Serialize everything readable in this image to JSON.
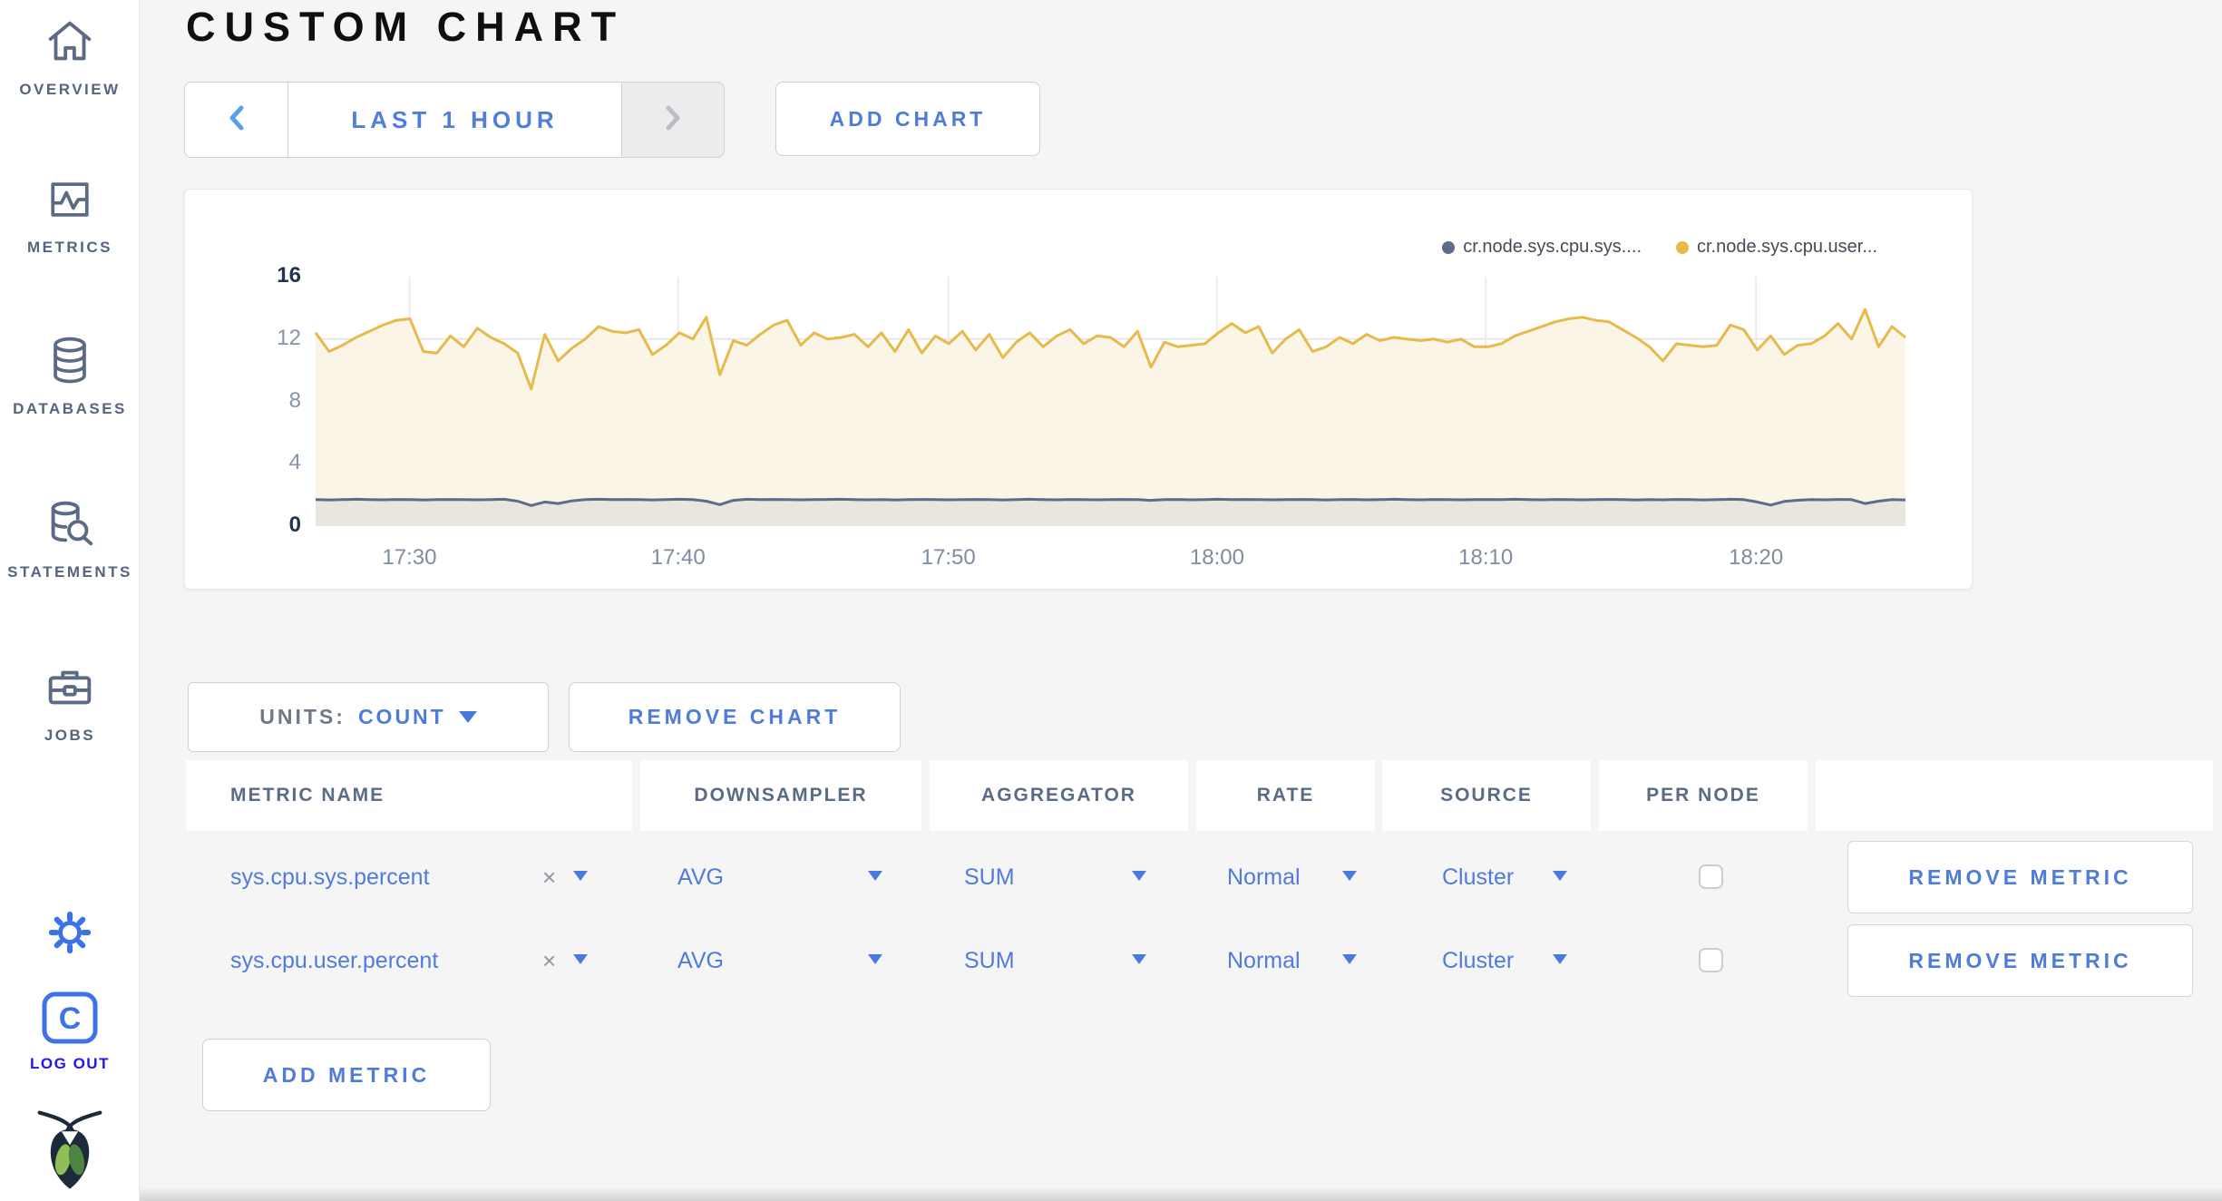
{
  "sidebar": {
    "items": [
      {
        "id": "overview",
        "label": "OVERVIEW"
      },
      {
        "id": "metrics",
        "label": "METRICS"
      },
      {
        "id": "databases",
        "label": "DATABASES"
      },
      {
        "id": "statements",
        "label": "STATEMENTS"
      },
      {
        "id": "jobs",
        "label": "JOBS"
      }
    ],
    "logout_label": "LOG OUT"
  },
  "header": {
    "title": "CUSTOM CHART",
    "time_window": "LAST 1 HOUR",
    "add_chart_label": "ADD CHART"
  },
  "chart_controls": {
    "units_label": "UNITS:",
    "units_value": "COUNT",
    "remove_chart_label": "REMOVE CHART",
    "add_metric_label": "ADD METRIC"
  },
  "table": {
    "columns": [
      "METRIC NAME",
      "DOWNSAMPLER",
      "AGGREGATOR",
      "RATE",
      "SOURCE",
      "PER NODE"
    ],
    "rows": [
      {
        "metric": "sys.cpu.sys.percent",
        "downsampler": "AVG",
        "aggregator": "SUM",
        "rate": "Normal",
        "source": "Cluster",
        "per_node_checked": false,
        "remove_label": "REMOVE METRIC"
      },
      {
        "metric": "sys.cpu.user.percent",
        "downsampler": "AVG",
        "aggregator": "SUM",
        "rate": "Normal",
        "source": "Cluster",
        "per_node_checked": false,
        "remove_label": "REMOVE METRIC"
      }
    ]
  },
  "chart_data": {
    "type": "line",
    "title": "",
    "xlabel": "",
    "ylabel": "",
    "ylim": [
      0,
      16
    ],
    "y_ticks": [
      0,
      4,
      8,
      12,
      16
    ],
    "x_ticks": [
      "17:30",
      "17:40",
      "17:50",
      "18:00",
      "18:10",
      "18:20"
    ],
    "x_tick_fractions": [
      0.059,
      0.228,
      0.398,
      0.567,
      0.736,
      0.906
    ],
    "grid": true,
    "legend_position": "top-right",
    "series": [
      {
        "name": "cr.node.sys.cpu.sys....",
        "color": "#5f6c87",
        "fill": "#e9e6e0",
        "values": [
          1.7,
          1.68,
          1.7,
          1.72,
          1.7,
          1.69,
          1.71,
          1.7,
          1.68,
          1.7,
          1.71,
          1.7,
          1.69,
          1.7,
          1.72,
          1.6,
          1.32,
          1.55,
          1.45,
          1.62,
          1.7,
          1.72,
          1.7,
          1.71,
          1.7,
          1.68,
          1.7,
          1.72,
          1.7,
          1.6,
          1.38,
          1.65,
          1.72,
          1.7,
          1.71,
          1.7,
          1.69,
          1.7,
          1.71,
          1.72,
          1.7,
          1.69,
          1.7,
          1.68,
          1.7,
          1.71,
          1.7,
          1.69,
          1.7,
          1.71,
          1.7,
          1.68,
          1.7,
          1.72,
          1.7,
          1.69,
          1.71,
          1.7,
          1.69,
          1.7,
          1.71,
          1.7,
          1.65,
          1.7,
          1.71,
          1.69,
          1.7,
          1.72,
          1.7,
          1.71,
          1.7,
          1.69,
          1.7,
          1.71,
          1.7,
          1.68,
          1.7,
          1.71,
          1.69,
          1.7,
          1.72,
          1.7,
          1.69,
          1.71,
          1.7,
          1.69,
          1.7,
          1.71,
          1.7,
          1.72,
          1.7,
          1.69,
          1.71,
          1.7,
          1.69,
          1.7,
          1.71,
          1.7,
          1.68,
          1.7,
          1.69,
          1.71,
          1.7,
          1.68,
          1.7,
          1.72,
          1.7,
          1.55,
          1.35,
          1.58,
          1.66,
          1.7,
          1.69,
          1.71,
          1.7,
          1.45,
          1.6,
          1.7,
          1.68
        ]
      },
      {
        "name": "cr.node.sys.cpu.user...",
        "color": "#e6ba4b",
        "fill": "#faf5e7",
        "values": [
          12.4,
          11.2,
          11.6,
          12.1,
          12.5,
          12.9,
          13.2,
          13.3,
          11.2,
          11.1,
          12.2,
          11.5,
          12.7,
          12.1,
          11.7,
          11.1,
          8.8,
          12.3,
          10.6,
          11.4,
          12.0,
          12.8,
          12.5,
          12.4,
          12.6,
          11.0,
          11.6,
          12.4,
          12.0,
          13.4,
          9.7,
          11.9,
          11.6,
          12.3,
          12.9,
          13.2,
          11.6,
          12.4,
          12.0,
          12.1,
          12.3,
          11.5,
          12.4,
          11.2,
          12.6,
          11.1,
          12.2,
          11.7,
          12.5,
          11.3,
          12.3,
          10.8,
          11.8,
          12.4,
          11.5,
          12.2,
          12.6,
          11.7,
          12.2,
          12.1,
          11.5,
          12.5,
          10.2,
          11.8,
          11.5,
          11.6,
          11.7,
          12.4,
          13.0,
          12.4,
          12.8,
          11.1,
          12.0,
          12.6,
          11.2,
          11.5,
          12.1,
          11.7,
          12.3,
          11.9,
          12.1,
          12.0,
          11.9,
          12.0,
          11.8,
          12.0,
          11.5,
          11.5,
          11.7,
          12.2,
          12.5,
          12.8,
          13.1,
          13.3,
          13.4,
          13.2,
          13.1,
          12.6,
          12.1,
          11.5,
          10.6,
          11.7,
          11.6,
          11.5,
          11.6,
          12.9,
          12.6,
          11.3,
          12.2,
          11.0,
          11.6,
          11.7,
          12.2,
          13.0,
          12.0,
          13.9,
          11.5,
          12.8,
          12.1
        ]
      }
    ]
  }
}
